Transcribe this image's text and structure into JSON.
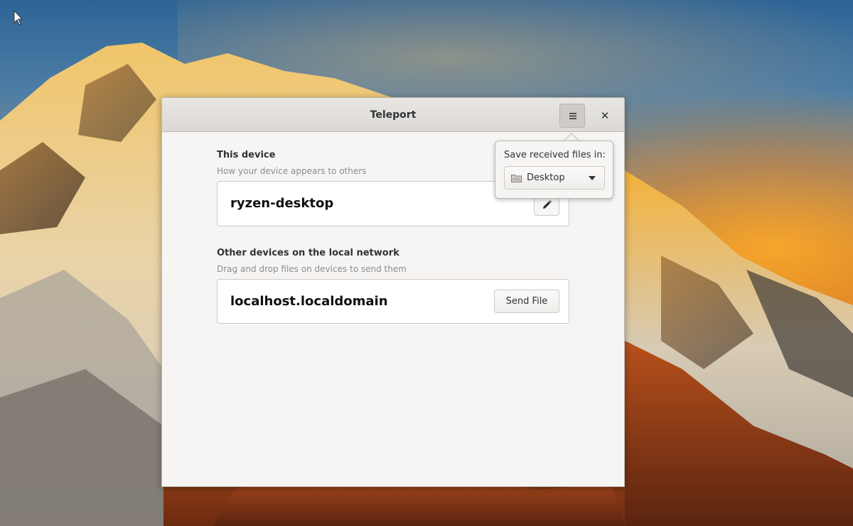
{
  "window": {
    "title": "Teleport"
  },
  "this_device": {
    "heading": "This device",
    "subtitle": "How your device appears to others",
    "name": "ryzen-desktop"
  },
  "other_devices": {
    "heading": "Other devices on the local network",
    "subtitle": "Drag and drop files on devices to send them",
    "items": [
      {
        "name": "localhost.localdomain",
        "action_label": "Send File"
      }
    ]
  },
  "popover": {
    "label": "Save received files in:",
    "selected_folder": "Desktop"
  },
  "icons": {
    "menu": "hamburger-menu-icon",
    "close": "close-icon",
    "edit": "pencil-icon",
    "folder": "folder-icon",
    "dropdown": "chevron-down-icon",
    "cursor": "mouse-pointer-icon"
  }
}
